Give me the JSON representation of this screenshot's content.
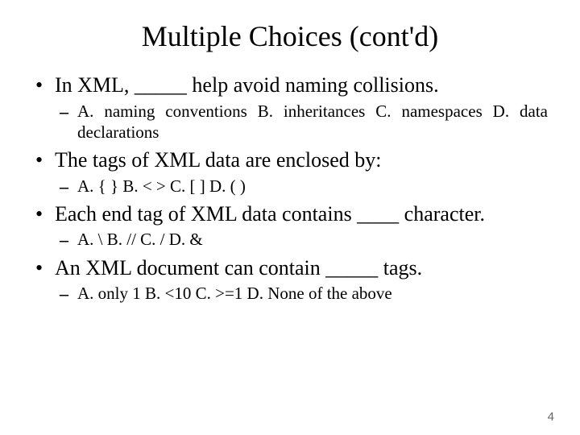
{
  "title": "Multiple Choices (cont'd)",
  "questions": [
    {
      "prompt": "In XML, _____ help avoid naming collisions.",
      "options": "A. naming conventions   B. inheritances C. namespaces   D. data declarations"
    },
    {
      "prompt": "The tags of XML data are enclosed by:",
      "options": "A. { }    B. < >    C. [ ]   D. ( )"
    },
    {
      "prompt": "Each end tag of XML data contains ____ character.",
      "options": "A. \\    B. //    C. /    D. &"
    },
    {
      "prompt": "An XML document can contain _____ tags.",
      "options": "A. only 1    B. <10    C. >=1    D. None of the above"
    }
  ],
  "page_number": "4"
}
